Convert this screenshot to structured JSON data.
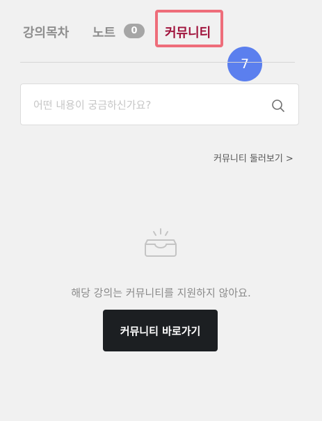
{
  "tabs": {
    "toc_label": "강의목차",
    "note_label": "노트",
    "note_count": "0",
    "community_label": "커뮤니티"
  },
  "step_badge": "7",
  "search": {
    "placeholder": "어떤 내용이 궁금하신가요?"
  },
  "browse_link": {
    "label": "커뮤니티 둘러보기",
    "chevron": ">"
  },
  "empty_state": {
    "icon": "inbox-tray-icon",
    "message": "해당 강의는 커뮤니티를 지원하지 않아요.",
    "button_label": "커뮤니티 바로가기"
  },
  "colors": {
    "active_tab": "#a0133c",
    "highlight_border": "#ee6d7a",
    "step_badge": "#5b7fee",
    "button_bg": "#1c1f22"
  }
}
